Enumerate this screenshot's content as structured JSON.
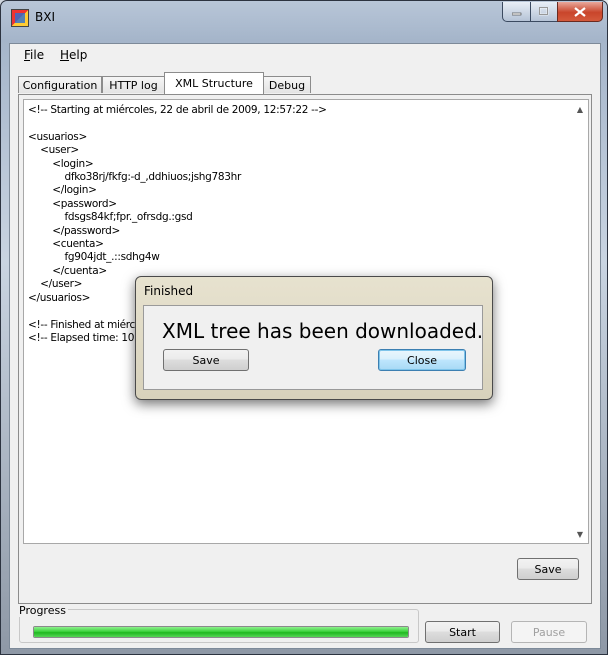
{
  "window": {
    "title": "BXI"
  },
  "menu": {
    "file": "File",
    "file_mnemonic": "F",
    "file_rest": "ile",
    "help": "Help",
    "help_mnemonic": "H",
    "help_rest": "elp"
  },
  "tabs": [
    {
      "label": "Configuration"
    },
    {
      "label": "HTTP log"
    },
    {
      "label": "XML Structure",
      "active": true
    },
    {
      "label": "Debug"
    }
  ],
  "xml_text": "<!-- Starting at miércoles, 22 de abril de 2009, 12:57:22 -->\n\n<usuarios>\n    <user>\n        <login>\n            dfko38rj/fkfg:-d_,ddhiuos;jshg783hr\n        </login>\n        <password>\n            fdsgs84kf;fpr._ofrsdg.:gsd\n        </password>\n        <cuenta>\n            fg904jdt_.::sdhg4w\n        </cuenta>\n    </user>\n</usuarios>\n\n<!-- Finished at miérco\n<!-- Elapsed time: 10,",
  "panel": {
    "save_label": "Save"
  },
  "progress": {
    "label": "Progress",
    "value": 100
  },
  "buttons": {
    "start_label": "Start",
    "pause_label": "Pause"
  },
  "dialog": {
    "title": "Finished",
    "message": "XML tree has been downloaded.",
    "save_label": "Save",
    "close_label": "Close"
  },
  "colors": {
    "progress_fill": "#2ec62e",
    "dialog_frame": "#d8d2bc",
    "close_button": "#c9452b"
  }
}
